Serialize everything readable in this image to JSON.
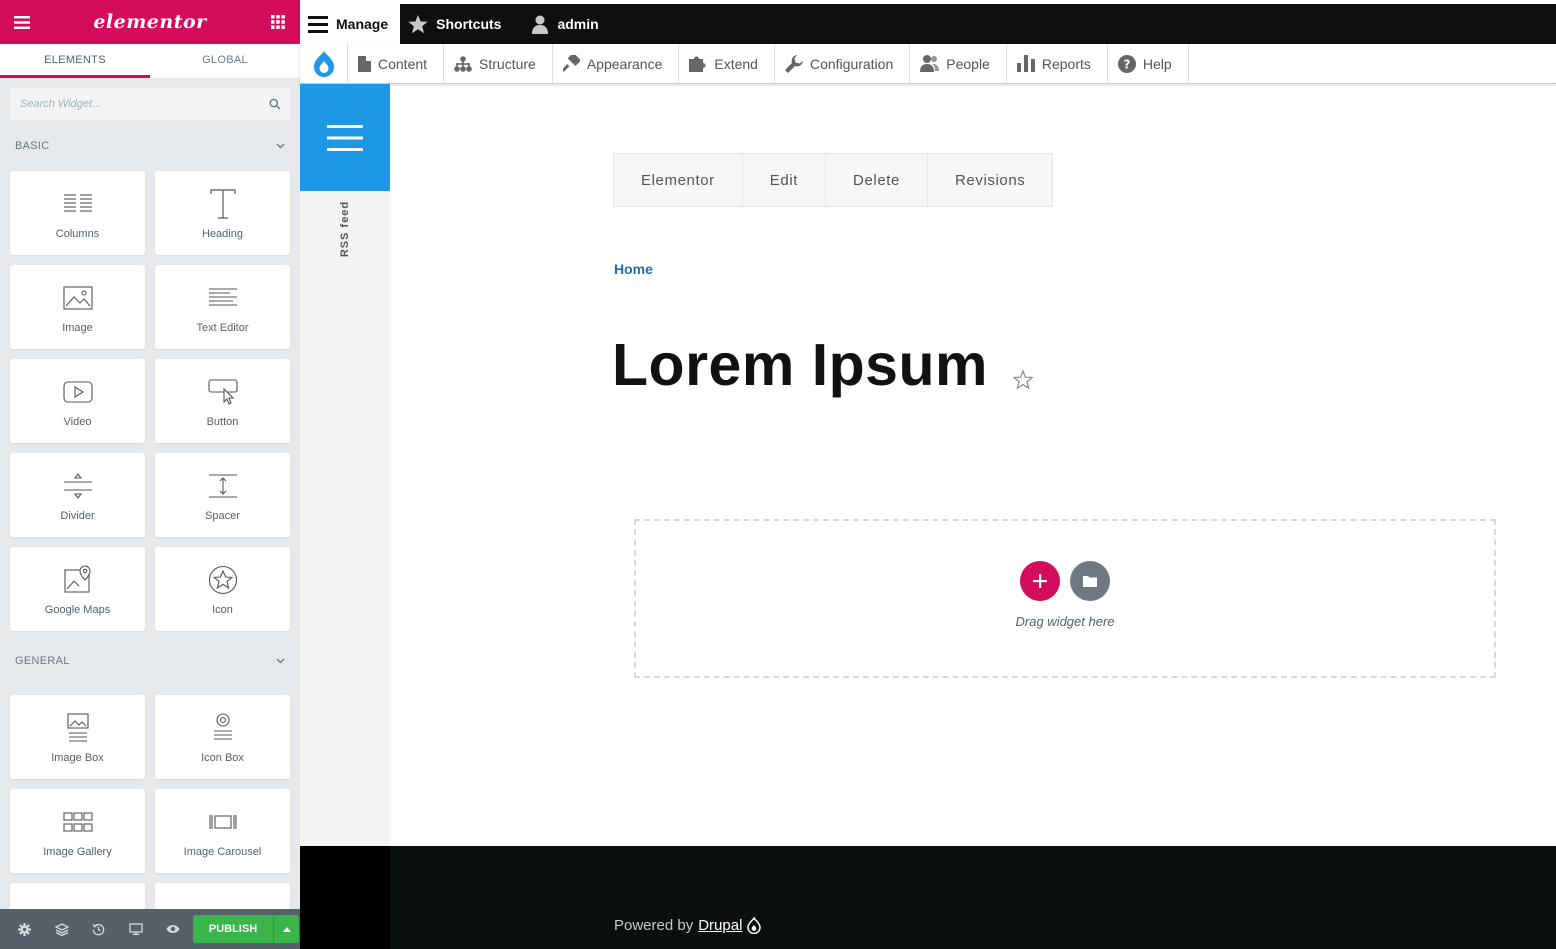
{
  "elementor": {
    "logo": "elementor",
    "tabs": [
      "ELEMENTS",
      "GLOBAL"
    ],
    "search_placeholder": "Search Widget...",
    "categories": [
      {
        "title": "BASIC",
        "widgets": [
          "Columns",
          "Heading",
          "Image",
          "Text Editor",
          "Video",
          "Button",
          "Divider",
          "Spacer",
          "Google Maps",
          "Icon"
        ]
      },
      {
        "title": "GENERAL",
        "widgets": [
          "Image Box",
          "Icon Box",
          "Image Gallery",
          "Image Carousel"
        ]
      }
    ],
    "footer": {
      "publish_label": "PUBLISH"
    }
  },
  "toolbar": {
    "manage": "Manage",
    "shortcuts": "Shortcuts",
    "user": "admin",
    "tray": [
      "Content",
      "Structure",
      "Appearance",
      "Extend",
      "Configuration",
      "People",
      "Reports",
      "Help"
    ]
  },
  "sidebar": {
    "rss": "RSS feed"
  },
  "tasks": [
    "Elementor",
    "Edit",
    "Delete",
    "Revisions"
  ],
  "breadcrumb": "Home",
  "page_title": "Lorem Ipsum",
  "drop_zone": {
    "text": "Drag widget here"
  },
  "footer": {
    "powered_by": "Powered by",
    "link": "Drupal"
  },
  "colors": {
    "elementor_pink": "#d30c5c",
    "drupal_blue": "#1d97e6",
    "publish_green": "#39b54a"
  }
}
